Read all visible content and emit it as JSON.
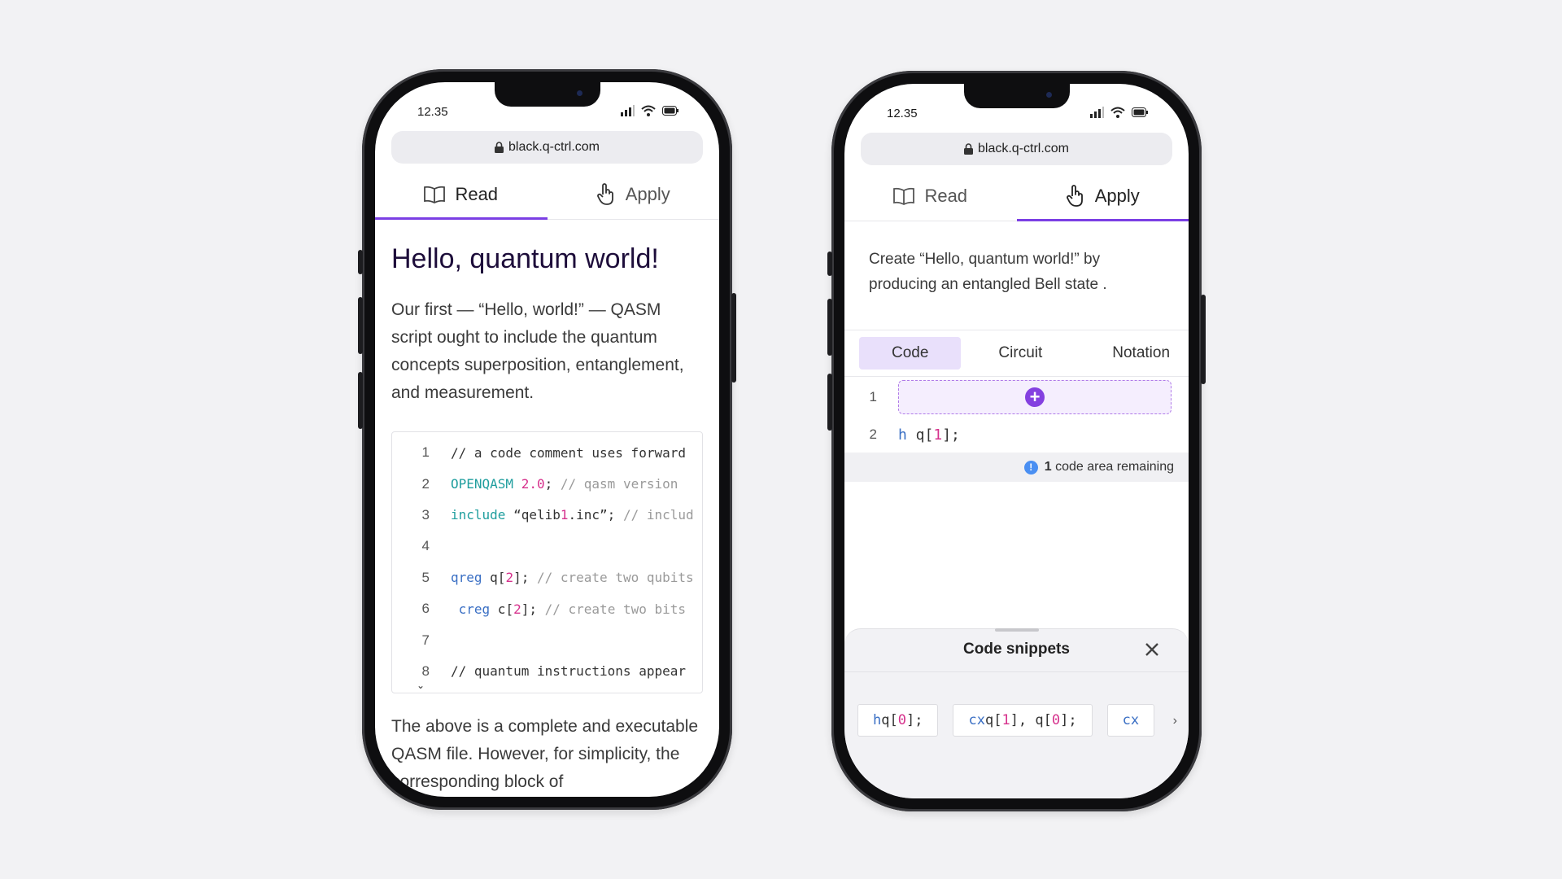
{
  "left_phone": {
    "status_time": "12.35",
    "url": "black.q-ctrl.com",
    "tabs": [
      {
        "label": "Read"
      },
      {
        "label": "Apply"
      }
    ],
    "active_tab": "Read",
    "title": "Hello, quantum world!",
    "paragraph1": "Our first — “Hello, world!” — QASM script ought to include the quantum concepts superposition, entanglement, and measurement.",
    "code_lines": [
      {
        "num": "1",
        "text": "// a code comment uses forward"
      },
      {
        "num": "2",
        "text": "OPENQASM 2.0; // qasm version"
      },
      {
        "num": "3",
        "text": "include “qelib1.inc”; // includ"
      },
      {
        "num": "4",
        "text": ""
      },
      {
        "num": "5",
        "text": "qreg q[2]; // create two qubits"
      },
      {
        "num": "6",
        "text": " creg c[2]; // create two bits"
      },
      {
        "num": "7",
        "text": ""
      },
      {
        "num": "8",
        "text": "// quantum instructions appear"
      }
    ],
    "paragraph2": "The above is a complete and executable QASM file. However, for simplicity, the corresponding block of"
  },
  "right_phone": {
    "status_time": "12.35",
    "url": "black.q-ctrl.com",
    "tabs": [
      {
        "label": "Read"
      },
      {
        "label": "Apply"
      }
    ],
    "active_tab": "Apply",
    "intro": "Create “Hello, quantum world!” by producing an entangled Bell state .",
    "subtabs": [
      {
        "label": "Code"
      },
      {
        "label": "Circuit"
      },
      {
        "label": "Notation"
      }
    ],
    "active_subtab": "Code",
    "editor_lines": [
      {
        "num": "1",
        "text": ""
      },
      {
        "num": "2",
        "text": "h q[1];"
      }
    ],
    "remaining_count": "1",
    "remaining_text": "code area remaining",
    "sheet_title": "Code snippets",
    "snippets": [
      {
        "text": "h q[0];"
      },
      {
        "text": "cx q[1], q[0];"
      },
      {
        "text": "cx"
      }
    ]
  },
  "colors": {
    "accent": "#7b3fe4",
    "keyword": "#1f9e9e",
    "number": "#d6318c",
    "register": "#3a6fc4",
    "comment": "#9a9a9a",
    "info": "#4a8ff2"
  }
}
